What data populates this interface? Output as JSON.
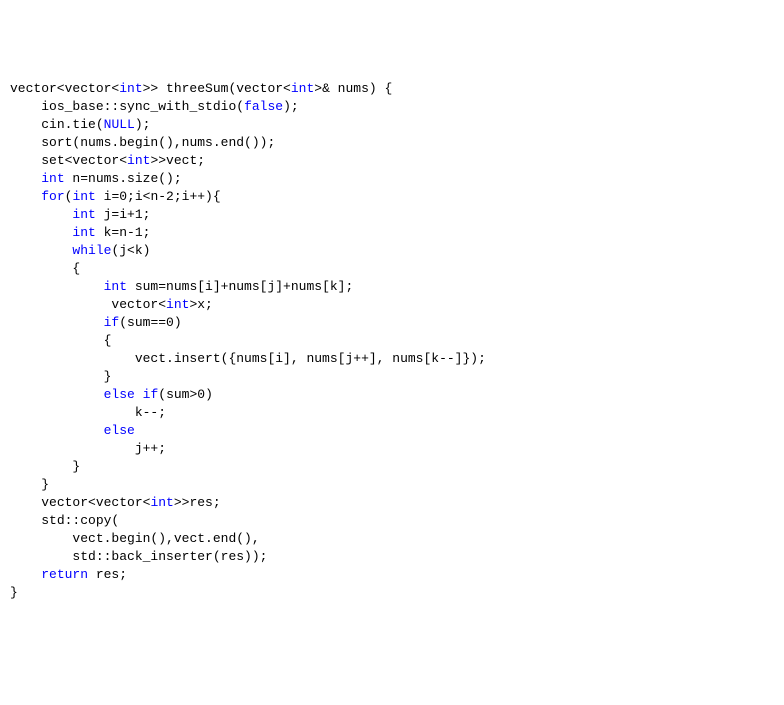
{
  "code": {
    "language": "cpp",
    "function_name": "threeSum",
    "lines": [
      {
        "indent": 0,
        "tokens": [
          [
            "plain",
            "vector<vector<"
          ],
          [
            "kw",
            "int"
          ],
          [
            "plain",
            ">> threeSum(vector<"
          ],
          [
            "kw",
            "int"
          ],
          [
            "plain",
            ">& nums) {"
          ]
        ]
      },
      {
        "indent": 1,
        "tokens": [
          [
            "plain",
            "ios_base::sync_with_stdio("
          ],
          [
            "kw",
            "false"
          ],
          [
            "plain",
            ");"
          ]
        ]
      },
      {
        "indent": 1,
        "tokens": [
          [
            "plain",
            "cin.tie("
          ],
          [
            "kw",
            "NULL"
          ],
          [
            "plain",
            ");"
          ]
        ]
      },
      {
        "indent": 1,
        "tokens": [
          [
            "plain",
            "sort(nums.begin(),nums.end());"
          ]
        ]
      },
      {
        "indent": 1,
        "tokens": [
          [
            "plain",
            "set<vector<"
          ],
          [
            "kw",
            "int"
          ],
          [
            "plain",
            ">>vect;"
          ]
        ]
      },
      {
        "indent": 1,
        "tokens": [
          [
            "kw",
            "int"
          ],
          [
            "plain",
            " n=nums.size();"
          ]
        ]
      },
      {
        "indent": 1,
        "tokens": [
          [
            "kw",
            "for"
          ],
          [
            "plain",
            "("
          ],
          [
            "kw",
            "int"
          ],
          [
            "plain",
            " i=0;i<n-2;i++){"
          ]
        ]
      },
      {
        "indent": 2,
        "tokens": [
          [
            "kw",
            "int"
          ],
          [
            "plain",
            " j=i+1;"
          ]
        ]
      },
      {
        "indent": 2,
        "tokens": [
          [
            "kw",
            "int"
          ],
          [
            "plain",
            " k=n-1;"
          ]
        ]
      },
      {
        "indent": 0,
        "tokens": [
          [
            "plain",
            ""
          ]
        ]
      },
      {
        "indent": 2,
        "tokens": [
          [
            "kw",
            "while"
          ],
          [
            "plain",
            "(j<k)"
          ]
        ]
      },
      {
        "indent": 2,
        "tokens": [
          [
            "plain",
            "{"
          ]
        ]
      },
      {
        "indent": 3,
        "tokens": [
          [
            "kw",
            "int"
          ],
          [
            "plain",
            " sum=nums[i]+nums[j]+nums[k];"
          ]
        ]
      },
      {
        "indent": 3,
        "tokens": [
          [
            "plain",
            " vector<"
          ],
          [
            "kw",
            "int"
          ],
          [
            "plain",
            ">x;"
          ]
        ]
      },
      {
        "indent": 3,
        "tokens": [
          [
            "kw",
            "if"
          ],
          [
            "plain",
            "(sum==0)"
          ]
        ]
      },
      {
        "indent": 3,
        "tokens": [
          [
            "plain",
            "{"
          ]
        ]
      },
      {
        "indent": 4,
        "tokens": [
          [
            "plain",
            "vect.insert({nums[i], nums[j++], nums[k--]});"
          ]
        ]
      },
      {
        "indent": 0,
        "tokens": [
          [
            "plain",
            ""
          ]
        ]
      },
      {
        "indent": 3,
        "tokens": [
          [
            "plain",
            "}"
          ]
        ]
      },
      {
        "indent": 3,
        "tokens": [
          [
            "kw",
            "else"
          ],
          [
            "plain",
            " "
          ],
          [
            "kw",
            "if"
          ],
          [
            "plain",
            "(sum>0)"
          ]
        ]
      },
      {
        "indent": 4,
        "tokens": [
          [
            "plain",
            "k--;"
          ]
        ]
      },
      {
        "indent": 3,
        "tokens": [
          [
            "kw",
            "else"
          ]
        ]
      },
      {
        "indent": 4,
        "tokens": [
          [
            "plain",
            "j++;"
          ]
        ]
      },
      {
        "indent": 0,
        "tokens": [
          [
            "plain",
            ""
          ]
        ]
      },
      {
        "indent": 2,
        "tokens": [
          [
            "plain",
            "}"
          ]
        ]
      },
      {
        "indent": 0,
        "tokens": [
          [
            "plain",
            ""
          ]
        ]
      },
      {
        "indent": 1,
        "tokens": [
          [
            "plain",
            "}"
          ]
        ]
      },
      {
        "indent": 1,
        "tokens": [
          [
            "plain",
            "vector<vector<"
          ],
          [
            "kw",
            "int"
          ],
          [
            "plain",
            ">>res;"
          ]
        ]
      },
      {
        "indent": 1,
        "tokens": [
          [
            "plain",
            "std::copy("
          ]
        ]
      },
      {
        "indent": 2,
        "tokens": [
          [
            "plain",
            "vect.begin(),vect.end(),"
          ]
        ]
      },
      {
        "indent": 2,
        "tokens": [
          [
            "plain",
            "std::back_inserter(res));"
          ]
        ]
      },
      {
        "indent": 1,
        "tokens": [
          [
            "kw",
            "return"
          ],
          [
            "plain",
            " res;"
          ]
        ]
      },
      {
        "indent": 0,
        "tokens": [
          [
            "plain",
            ""
          ]
        ]
      },
      {
        "indent": 0,
        "tokens": [
          [
            "plain",
            "}"
          ]
        ]
      }
    ]
  }
}
